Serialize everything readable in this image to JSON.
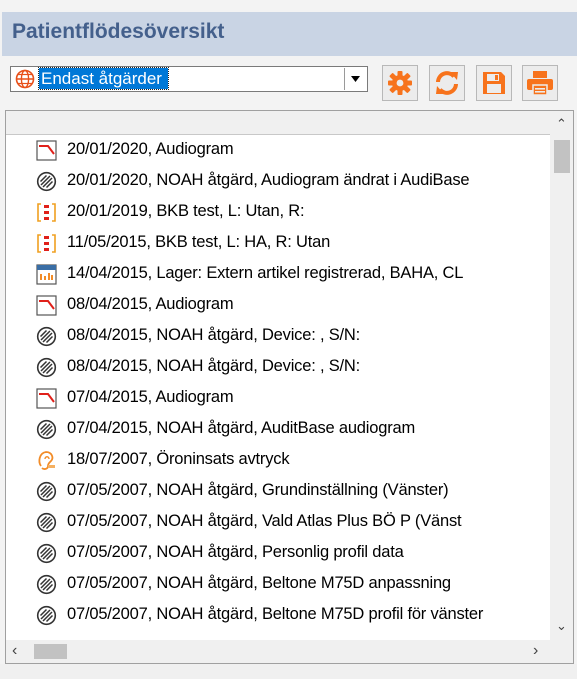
{
  "panel": {
    "title": "Patientflödesöversikt"
  },
  "toolbar": {
    "filter_value": "Endast åtgärder",
    "filter_icon": "globe-icon",
    "buttons": [
      {
        "name": "settings-button",
        "icon": "gear-icon"
      },
      {
        "name": "refresh-button",
        "icon": "refresh-icon"
      },
      {
        "name": "save-button",
        "icon": "floppy-disk-icon"
      },
      {
        "name": "print-button",
        "icon": "printer-icon"
      }
    ]
  },
  "list": {
    "rows": [
      {
        "icon": "audiogram-icon",
        "text": "20/01/2020, Audiogram"
      },
      {
        "icon": "noah-icon",
        "text": "20/01/2020, NOAH åtgärd, Audiogram ändrat i AudiBase"
      },
      {
        "icon": "bkb-test-icon",
        "text": "20/01/2019, BKB test, L: Utan, R:"
      },
      {
        "icon": "bkb-test-icon",
        "text": "11/05/2015, BKB test, L: HA, R: Utan"
      },
      {
        "icon": "stock-icon",
        "text": "14/04/2015, Lager: Extern artikel registrerad, BAHA, CL"
      },
      {
        "icon": "audiogram-icon",
        "text": "08/04/2015, Audiogram"
      },
      {
        "icon": "noah-icon",
        "text": "08/04/2015, NOAH åtgärd, Device: , S/N:"
      },
      {
        "icon": "noah-icon",
        "text": "08/04/2015, NOAH åtgärd, Device: , S/N:"
      },
      {
        "icon": "audiogram-icon",
        "text": "07/04/2015, Audiogram"
      },
      {
        "icon": "noah-icon",
        "text": "07/04/2015, NOAH åtgärd, AuditBase audiogram"
      },
      {
        "icon": "ear-impression-icon",
        "text": "18/07/2007, Öroninsats avtryck"
      },
      {
        "icon": "noah-icon",
        "text": "07/05/2007, NOAH åtgärd, Grundinställning (Vänster)"
      },
      {
        "icon": "noah-icon",
        "text": "07/05/2007, NOAH åtgärd, Vald Atlas Plus BÖ P (Vänst"
      },
      {
        "icon": "noah-icon",
        "text": "07/05/2007, NOAH åtgärd, Personlig profil data"
      },
      {
        "icon": "noah-icon",
        "text": "07/05/2007, NOAH åtgärd, Beltone M75D anpassning"
      },
      {
        "icon": "noah-icon",
        "text": "07/05/2007, NOAH åtgärd, Beltone M75D profil för vänster"
      }
    ]
  },
  "colors": {
    "accent_orange": "#f7731c",
    "title_bar": "#c9d4e4",
    "title_text": "#44608c",
    "selection": "#0078d7"
  }
}
